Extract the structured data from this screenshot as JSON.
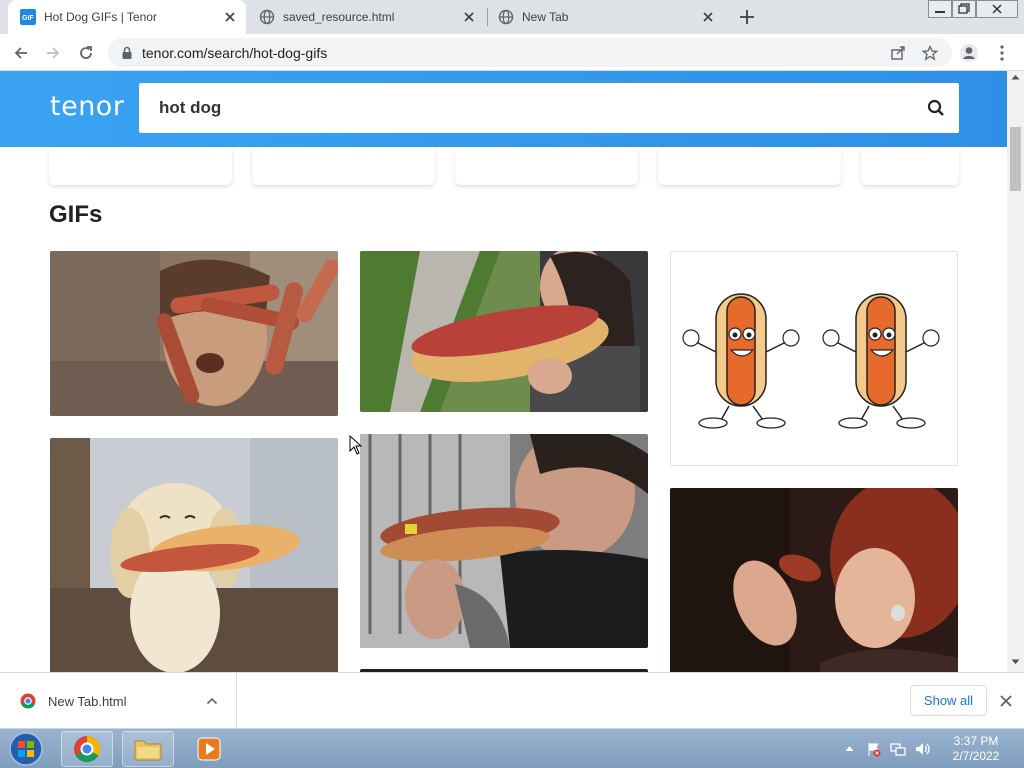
{
  "browser": {
    "tabs": [
      {
        "title": "Hot Dog GIFs | Tenor",
        "active": true
      },
      {
        "title": "saved_resource.html",
        "active": false
      },
      {
        "title": "New Tab",
        "active": false
      }
    ],
    "url": "tenor.com/search/hot-dog-gifs"
  },
  "tenor": {
    "logo": "tenor",
    "search": {
      "value": "hot dog"
    },
    "section_heading": "GIFs",
    "gifs": [
      {
        "name": "gif-woman-hot-dogs-on-face",
        "icon": "photo"
      },
      {
        "name": "gif-woman-eating-giant-hot-dog",
        "icon": "photo"
      },
      {
        "name": "gif-dancing-hot-dogs-cartoon",
        "icon": "illustration"
      },
      {
        "name": "gif-dog-holding-hot-dog",
        "icon": "photo"
      },
      {
        "name": "gif-man-eating-hot-dog",
        "icon": "photo"
      },
      {
        "name": "gif-woman-eating-hot-dog",
        "icon": "photo"
      }
    ]
  },
  "downloads": {
    "item_name": "New Tab.html",
    "show_all_label": "Show all"
  },
  "taskbar": {
    "time": "3:37 PM",
    "date": "2/7/2022"
  },
  "colors": {
    "tenor_blue": "#3aa3f2",
    "link_blue": "#1a73e8"
  }
}
